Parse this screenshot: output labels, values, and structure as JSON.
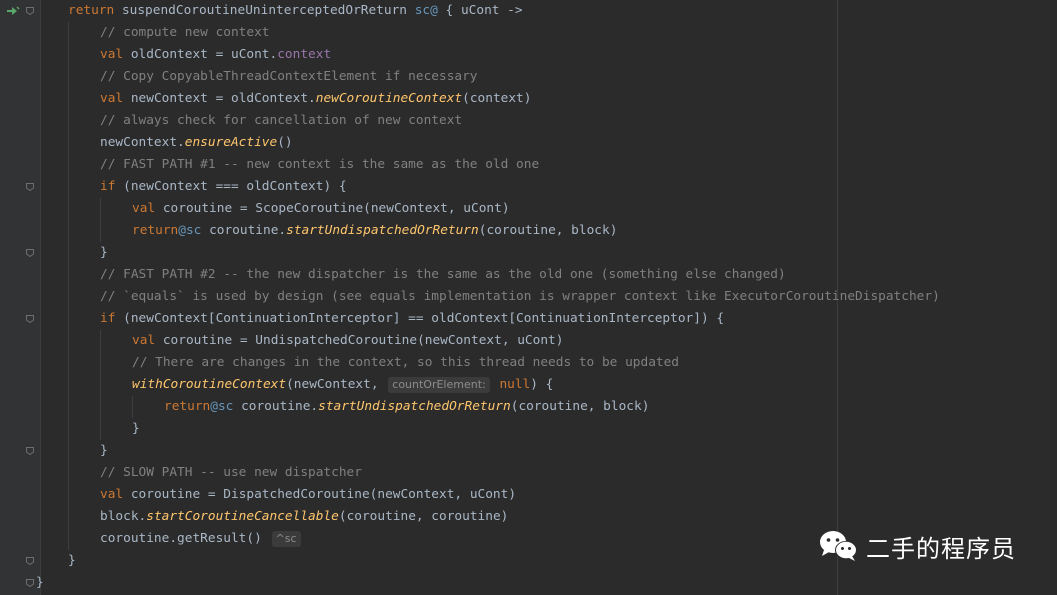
{
  "code_lines": [
    {
      "indent": 1,
      "tokens": [
        {
          "t": "return ",
          "c": "kw"
        },
        {
          "t": "suspendCoroutineUninterceptedOrReturn ",
          "c": ""
        },
        {
          "t": "sc@",
          "c": "lbl"
        },
        {
          "t": " { uCont ->",
          "c": ""
        }
      ]
    },
    {
      "indent": 2,
      "tokens": [
        {
          "t": "// compute new context",
          "c": "cm"
        }
      ]
    },
    {
      "indent": 2,
      "tokens": [
        {
          "t": "val ",
          "c": "kw"
        },
        {
          "t": "oldContext = uCont.",
          "c": ""
        },
        {
          "t": "context",
          "c": "prop"
        }
      ]
    },
    {
      "indent": 2,
      "tokens": [
        {
          "t": "// Copy CopyableThreadContextElement if necessary",
          "c": "cm"
        }
      ]
    },
    {
      "indent": 2,
      "tokens": [
        {
          "t": "val ",
          "c": "kw"
        },
        {
          "t": "newContext = oldContext.",
          "c": ""
        },
        {
          "t": "newCoroutineContext",
          "c": "fn"
        },
        {
          "t": "(context)",
          "c": ""
        }
      ]
    },
    {
      "indent": 2,
      "tokens": [
        {
          "t": "// always check for cancellation of new context",
          "c": "cm"
        }
      ]
    },
    {
      "indent": 2,
      "tokens": [
        {
          "t": "newContext.",
          "c": ""
        },
        {
          "t": "ensureActive",
          "c": "fn"
        },
        {
          "t": "()",
          "c": ""
        }
      ]
    },
    {
      "indent": 2,
      "tokens": [
        {
          "t": "// FAST PATH #1 -- new context is the same as the old one",
          "c": "cm"
        }
      ]
    },
    {
      "indent": 2,
      "tokens": [
        {
          "t": "if ",
          "c": "kw"
        },
        {
          "t": "(newContext === oldContext) {",
          "c": ""
        }
      ]
    },
    {
      "indent": 3,
      "tokens": [
        {
          "t": "val ",
          "c": "kw"
        },
        {
          "t": "coroutine = ScopeCoroutine(newContext, uCont)",
          "c": ""
        }
      ]
    },
    {
      "indent": 3,
      "tokens": [
        {
          "t": "return",
          "c": "kw"
        },
        {
          "t": "@sc",
          "c": "lbl"
        },
        {
          "t": " coroutine.",
          "c": ""
        },
        {
          "t": "startUndispatchedOrReturn",
          "c": "fn"
        },
        {
          "t": "(coroutine, block)",
          "c": ""
        }
      ]
    },
    {
      "indent": 2,
      "tokens": [
        {
          "t": "}",
          "c": ""
        }
      ]
    },
    {
      "indent": 2,
      "tokens": [
        {
          "t": "// FAST PATH #2 -- the new dispatcher is the same as the old one (something else changed)",
          "c": "cm"
        }
      ]
    },
    {
      "indent": 2,
      "tokens": [
        {
          "t": "// `equals` is used by design (see equals implementation is wrapper context like ExecutorCoroutineDispatcher)",
          "c": "cm"
        }
      ]
    },
    {
      "indent": 2,
      "tokens": [
        {
          "t": "if ",
          "c": "kw"
        },
        {
          "t": "(newContext[ContinuationInterceptor] == oldContext[ContinuationInterceptor]) {",
          "c": ""
        }
      ]
    },
    {
      "indent": 3,
      "tokens": [
        {
          "t": "val ",
          "c": "kw"
        },
        {
          "t": "coroutine = UndispatchedCoroutine(newContext, uCont)",
          "c": ""
        }
      ]
    },
    {
      "indent": 3,
      "tokens": [
        {
          "t": "// There are changes in the context, so this thread needs to be updated",
          "c": "cm"
        }
      ]
    },
    {
      "indent": 3,
      "tokens": [
        {
          "t": "withCoroutineContext",
          "c": "fn"
        },
        {
          "t": "(newContext, ",
          "c": ""
        },
        {
          "t": "countOrElement:",
          "c": "hint"
        },
        {
          "t": " null",
          "c": "kw"
        },
        {
          "t": ") {",
          "c": ""
        }
      ]
    },
    {
      "indent": 4,
      "tokens": [
        {
          "t": "return",
          "c": "kw"
        },
        {
          "t": "@sc",
          "c": "lbl"
        },
        {
          "t": " coroutine.",
          "c": ""
        },
        {
          "t": "startUndispatchedOrReturn",
          "c": "fn"
        },
        {
          "t": "(coroutine, block)",
          "c": ""
        }
      ]
    },
    {
      "indent": 3,
      "tokens": [
        {
          "t": "}",
          "c": ""
        }
      ]
    },
    {
      "indent": 2,
      "tokens": [
        {
          "t": "}",
          "c": ""
        }
      ]
    },
    {
      "indent": 2,
      "tokens": [
        {
          "t": "// SLOW PATH -- use new dispatcher",
          "c": "cm"
        }
      ]
    },
    {
      "indent": 2,
      "tokens": [
        {
          "t": "val ",
          "c": "kw"
        },
        {
          "t": "coroutine = DispatchedCoroutine(newContext, uCont)",
          "c": ""
        }
      ]
    },
    {
      "indent": 2,
      "tokens": [
        {
          "t": "block.",
          "c": ""
        },
        {
          "t": "startCoroutineCancellable",
          "c": "fn"
        },
        {
          "t": "(coroutine, coroutine)",
          "c": ""
        }
      ]
    },
    {
      "indent": 2,
      "tokens": [
        {
          "t": "coroutine.getResult() ",
          "c": ""
        },
        {
          "t": "^sc",
          "c": "hint"
        }
      ]
    },
    {
      "indent": 1,
      "tokens": [
        {
          "t": "}",
          "c": ""
        }
      ]
    },
    {
      "indent": 0,
      "tokens": [
        {
          "t": "}",
          "c": ""
        }
      ]
    }
  ],
  "watermark": {
    "text": "二手的程序员",
    "icon": "wechat-icon"
  },
  "colors": {
    "background": "#2b2b2b",
    "keyword": "#cc7832",
    "function": "#ffc66d",
    "comment": "#808080",
    "label": "#6897bb",
    "property": "#9876aa",
    "text": "#a9b7c6"
  }
}
